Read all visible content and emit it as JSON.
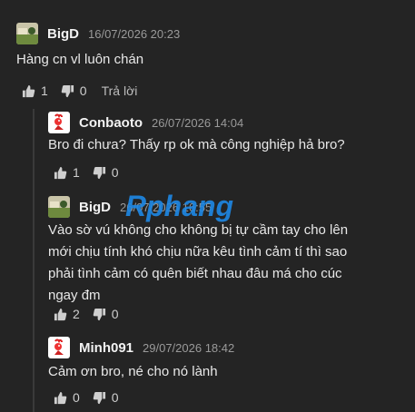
{
  "comments": [
    {
      "author": "BigD",
      "time": "16/07/2026 20:23",
      "text": "Hàng cn vl luôn chán",
      "likes": "1",
      "dislikes": "0",
      "reply_label": "Trả lời",
      "avatar_icon": "landscape-avatar-icon"
    },
    {
      "author": "Conbaoto",
      "time": "26/07/2026 14:04",
      "text": "Bro đi chưa? Thấy rp ok mà công nghiệp hả bro?",
      "likes": "1",
      "dislikes": "0",
      "avatar_icon": "rooster-avatar-icon"
    },
    {
      "author": "BigD",
      "time": "26/07/2026 16:55",
      "text_lines": [
        "Vào sờ vú không cho không bị tự cầm tay cho lên",
        "mới chịu tính khó chịu nữa kêu tình cảm tí thì sao",
        "phải tình cảm có quên biết nhau đâu má cho cúc",
        "ngay đm"
      ],
      "likes": "2",
      "dislikes": "0",
      "avatar_icon": "landscape-avatar-icon"
    },
    {
      "author": "Minh091",
      "time": "29/07/2026 18:42",
      "text": "Cảm ơn bro, né cho nó lành",
      "likes": "0",
      "dislikes": "0",
      "avatar_icon": "rooster-avatar-icon"
    }
  ],
  "watermark": "Rphang",
  "colors": {
    "background": "#242424",
    "watermark": "#1e88e5",
    "thread_line": "#3a3a3a"
  }
}
